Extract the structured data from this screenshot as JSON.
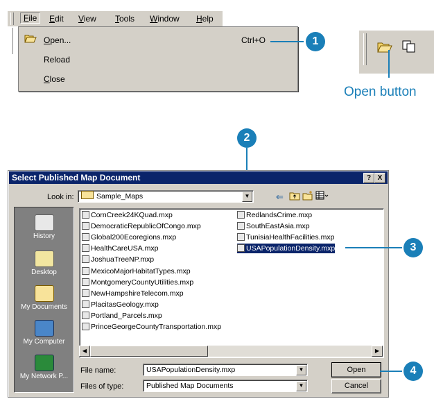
{
  "menubar": {
    "items": [
      {
        "label": "File",
        "hotkey": "F",
        "rest": "ile"
      },
      {
        "label": "Edit",
        "hotkey": "E",
        "rest": "dit"
      },
      {
        "label": "View",
        "hotkey": "V",
        "rest": "iew"
      },
      {
        "label": "Tools",
        "hotkey": "T",
        "rest": "ools"
      },
      {
        "label": "Window",
        "hotkey": "W",
        "rest": "indow"
      },
      {
        "label": "Help",
        "hotkey": "H",
        "rest": "elp"
      }
    ]
  },
  "file_menu": {
    "open": {
      "hotkey": "O",
      "rest": "pen...",
      "shortcut": "Ctrl+O",
      "icon": "open-folder-icon"
    },
    "reload": "Reload",
    "close": {
      "hotkey": "C",
      "rest": "lose"
    }
  },
  "toolbar": {
    "icons": [
      "open-folder-icon",
      "copy-icon"
    ],
    "label": "Open button"
  },
  "callouts": [
    "1",
    "2",
    "3",
    "4"
  ],
  "dialog": {
    "title": "Select Published Map Document",
    "title_buttons": [
      "?",
      "X"
    ],
    "look_in_label": "Look in:",
    "look_in_value": "Sample_Maps",
    "places": [
      "History",
      "Desktop",
      "My Documents",
      "My Computer",
      "My Network P..."
    ],
    "files_col1": [
      "CornCreek24KQuad.mxp",
      "DemocraticRepublicOfCongo.mxp",
      "Global200Ecoregions.mxp",
      "HealthCareUSA.mxp",
      "JoshuaTreeNP.mxp",
      "MexicoMajorHabitatTypes.mxp",
      "MontgomeryCountyUtilities.mxp",
      "NewHampshireTelecom.mxp",
      "PlacitasGeology.mxp",
      "Portland_Parcels.mxp",
      "PrinceGeorgeCountyTransportation.mxp"
    ],
    "files_col2": [
      "RedlandsCrime.mxp",
      "SouthEastAsia.mxp",
      "TunisiaHealthFacilities.mxp",
      "USAPopulationDensity.mxp"
    ],
    "selected_file": "USAPopulationDensity.mxp",
    "file_name_label": "File name:",
    "file_name_value": "USAPopulationDensity.mxp",
    "files_of_type_label": "Files of type:",
    "files_of_type_value": "Published Map Documents",
    "open_button": "Open",
    "cancel_button": "Cancel"
  },
  "colors": {
    "callout": "#1a7fb8",
    "titlebar": "#0a246a",
    "face": "#d4d0c8"
  }
}
